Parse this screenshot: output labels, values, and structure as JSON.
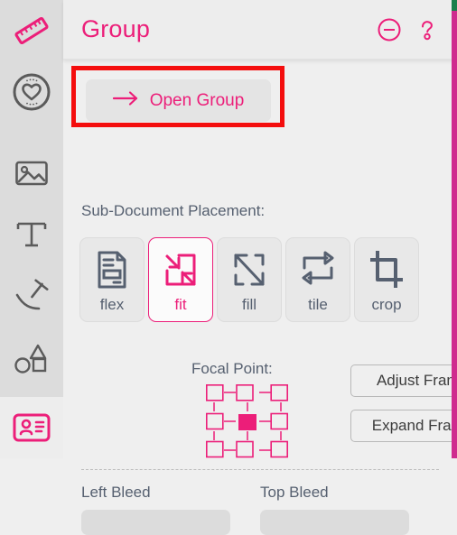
{
  "colors": {
    "accent_pink": "#ec1e79",
    "text_slate": "#566070",
    "highlight_red": "#f40d0d",
    "panel_bg": "#efefef",
    "sidebar_bg": "#dcdcdc",
    "edge_green": "#1a7f4b",
    "edge_pink": "#cf2b8e"
  },
  "sidebar": {
    "items": [
      {
        "name": "ruler-icon",
        "label": "Measure",
        "active": true
      },
      {
        "name": "heart-badge-icon",
        "label": "Favorites",
        "active": false
      },
      {
        "name": "image-icon",
        "label": "Image",
        "active": false
      },
      {
        "name": "text-icon",
        "label": "Text",
        "active": false
      },
      {
        "name": "pen-curve-icon",
        "label": "Pen",
        "active": false
      },
      {
        "name": "shapes-icon",
        "label": "Shapes",
        "active": false
      }
    ],
    "bottom_item": {
      "name": "id-card-icon",
      "label": "Card",
      "active": true
    }
  },
  "header": {
    "title": "Group",
    "collapse_icon": "minus-circle-icon",
    "help_icon": "question-mark-icon"
  },
  "open_group": {
    "label": "Open Group",
    "arrow_icon": "arrow-right-icon",
    "highlighted": true
  },
  "placement": {
    "label": "Sub-Document Placement:",
    "selected": "fit",
    "options": [
      {
        "id": "flex",
        "label": "flex",
        "icon": "document-lines-icon"
      },
      {
        "id": "fit",
        "label": "fit",
        "icon": "arrows-in-square-icon"
      },
      {
        "id": "fill",
        "label": "fill",
        "icon": "arrows-out-square-icon"
      },
      {
        "id": "tile",
        "label": "tile",
        "icon": "repeat-arrows-icon"
      },
      {
        "id": "crop",
        "label": "crop",
        "icon": "crop-icon"
      }
    ]
  },
  "focal_point": {
    "label": "Focal Point:",
    "grid_name": "focal-point-grid",
    "selected_cell": "center",
    "cells": [
      "top-left",
      "top-center",
      "top-right",
      "middle-left",
      "center",
      "middle-right",
      "bottom-left",
      "bottom-center",
      "bottom-right"
    ]
  },
  "frame_actions": [
    {
      "id": "adjust-frame",
      "label": "Adjust Frame"
    },
    {
      "id": "expand-frame",
      "label": "Expand Frame"
    }
  ],
  "bleed": [
    {
      "id": "left-bleed",
      "label": "Left Bleed",
      "value": "",
      "placeholder": ""
    },
    {
      "id": "top-bleed",
      "label": "Top Bleed",
      "value": "",
      "placeholder": ""
    }
  ]
}
